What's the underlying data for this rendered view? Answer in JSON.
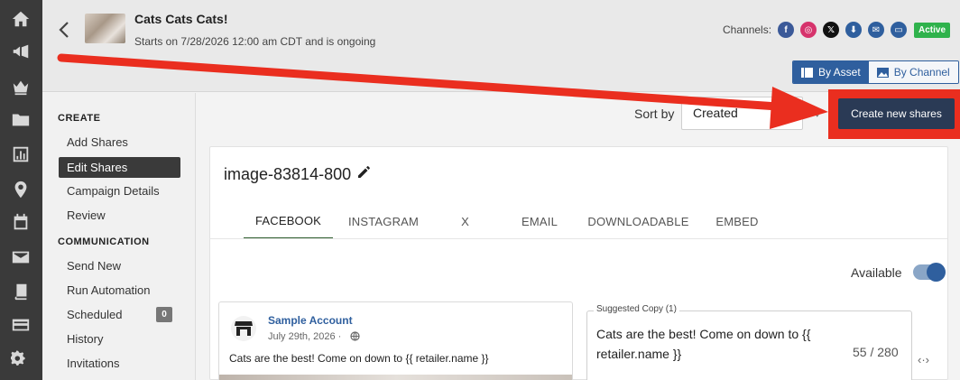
{
  "header": {
    "title": "Cats Cats Cats!",
    "subtitle": "Starts on 7/28/2026 12:00 am CDT and is ongoing",
    "channels_label": "Channels:",
    "channels": [
      {
        "name": "facebook-icon",
        "color": "#3b5998",
        "glyph": "f"
      },
      {
        "name": "instagram-icon",
        "color": "#d6336c",
        "glyph": "◎"
      },
      {
        "name": "x-icon",
        "color": "#111111",
        "glyph": "𝕏"
      },
      {
        "name": "download-icon",
        "color": "#2f5f9e",
        "glyph": "⬇"
      },
      {
        "name": "email-icon",
        "color": "#2f5f9e",
        "glyph": "✉"
      },
      {
        "name": "embed-icon",
        "color": "#2f5f9e",
        "glyph": "▭"
      }
    ],
    "status_badge": "Active",
    "view_toggle": {
      "by_asset": "By Asset",
      "by_channel": "By Channel"
    }
  },
  "sidebar": {
    "create_heading": "CREATE",
    "create_items": [
      "Add Shares",
      "Edit Shares",
      "Campaign Details",
      "Review"
    ],
    "communication_heading": "COMMUNICATION",
    "communication_items": [
      "Send New",
      "Run Automation",
      "Scheduled",
      "History",
      "Invitations"
    ],
    "scheduled_count": "0"
  },
  "toolbar": {
    "sort_label": "Sort by",
    "sort_value": "Created",
    "sort_direction": "↓",
    "create_button": "Create new shares"
  },
  "asset": {
    "name": "image-83814-800",
    "tabs": [
      "FACEBOOK",
      "INSTAGRAM",
      "X",
      "EMAIL",
      "DOWNLOADABLE",
      "EMBED"
    ],
    "selected_tab": "FACEBOOK",
    "available_label": "Available",
    "available": true
  },
  "preview": {
    "account": "Sample Account",
    "date": "July 29th, 2026 ·",
    "text": "Cats are the best! Come on down to {{ retailer.name }}"
  },
  "copy": {
    "legend": "Suggested Copy (1)",
    "text": "Cats are the best! Come on down to {{ retailer.name }}",
    "count": "55 / 280",
    "expand": "‹·›"
  },
  "colors": {
    "rail": "#3a3a3a",
    "accent_blue": "#2f5f9e",
    "create_button": "#2a3a55",
    "highlight_red": "#ea2e1f",
    "active_green": "#2fb24c"
  }
}
